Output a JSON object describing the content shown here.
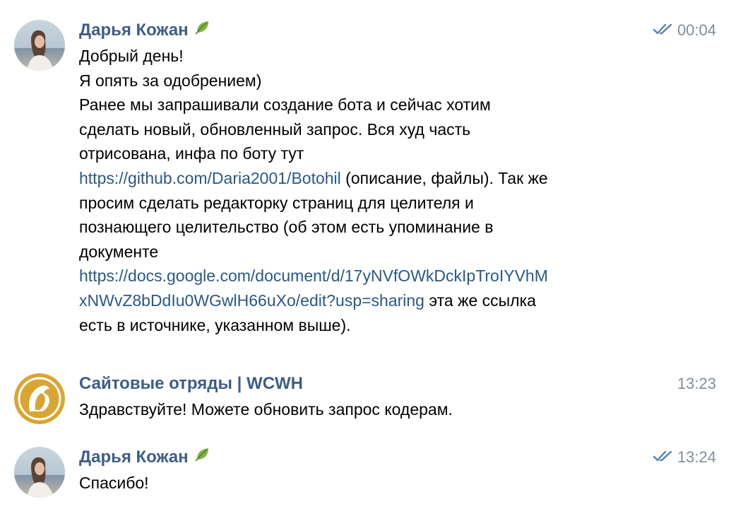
{
  "messages": [
    {
      "author": "Дарья Кожан",
      "time": "00:04",
      "status": "read",
      "lines": [
        {
          "segments": [
            {
              "text": "Добрый день!"
            }
          ]
        },
        {
          "segments": [
            {
              "text": "Я опять за одобрением)"
            }
          ]
        },
        {
          "segments": [
            {
              "text": "Ранее мы запрашивали создание бота и сейчас хотим"
            }
          ]
        },
        {
          "segments": [
            {
              "text": "сделать новый, обновленный запрос. Вся худ часть"
            }
          ]
        },
        {
          "segments": [
            {
              "text": "отрисована, инфа по боту тут"
            }
          ]
        },
        {
          "segments": [
            {
              "text": "https://github.com/Daria2001/Botohil",
              "link": true
            },
            {
              "text": " (описание, файлы). Так же"
            }
          ]
        },
        {
          "segments": [
            {
              "text": "просим сделать редакторку страниц для целителя и"
            }
          ]
        },
        {
          "segments": [
            {
              "text": "познающего целительство (об этом есть упоминание в"
            }
          ]
        },
        {
          "segments": [
            {
              "text": "документе"
            }
          ]
        },
        {
          "segments": [
            {
              "text": "https://docs.google.com/document/d/17yNVfOWkDckIpTroIYVhM",
              "link": true
            }
          ]
        },
        {
          "segments": [
            {
              "text": "xNWvZ8bDdIu0WGwlH66uXo/edit?usp=sharing",
              "link": true
            },
            {
              "text": " эта же ссылка"
            }
          ]
        },
        {
          "segments": [
            {
              "text": "есть в источнике, указанном выше)."
            }
          ]
        }
      ]
    },
    {
      "author": "Сайтовые отряды | WCWH",
      "time": "13:23",
      "text": "Здравствуйте! Можете обновить запрос кодерам."
    },
    {
      "author": "Дарья Кожан",
      "time": "13:24",
      "status": "read",
      "text": "Спасибо!"
    }
  ],
  "icons": {
    "author_badge": "leaf-emoji-icon",
    "read_status": "double-check-icon"
  },
  "colors": {
    "author": "#3e5e85",
    "link": "#2a5885",
    "timestamp": "#818c99",
    "check": "#5a7fb0",
    "group_avatar": "#d9a532"
  }
}
